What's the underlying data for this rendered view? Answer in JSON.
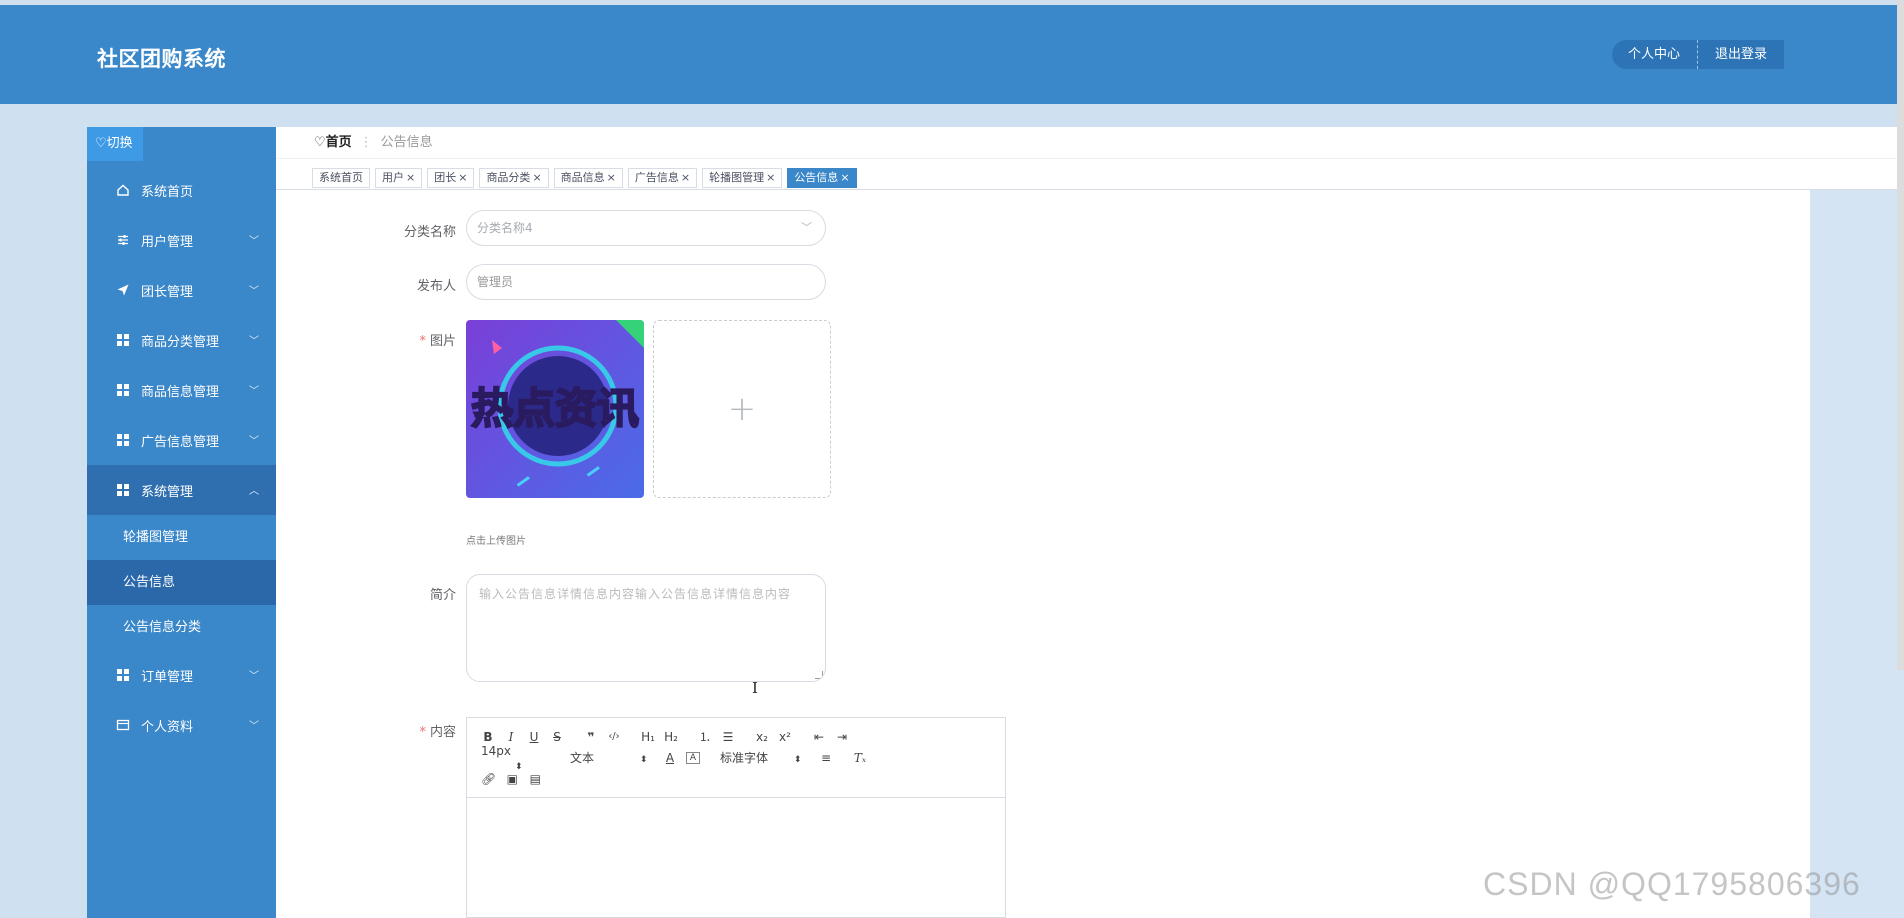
{
  "header": {
    "title": "社区团购系统",
    "personal_center": "个人中心",
    "logout": "退出登录"
  },
  "sidebar": {
    "switch_label": "♡切换",
    "items": [
      {
        "label": "系统首页",
        "icon": "home-icon"
      },
      {
        "label": "用户管理",
        "icon": "sliders-icon"
      },
      {
        "label": "团长管理",
        "icon": "send-icon"
      },
      {
        "label": "商品分类管理",
        "icon": "grid-icon"
      },
      {
        "label": "商品信息管理",
        "icon": "grid-icon"
      },
      {
        "label": "广告信息管理",
        "icon": "grid-icon"
      },
      {
        "label": "系统管理",
        "icon": "grid-icon"
      }
    ],
    "system_sub": [
      "轮播图管理",
      "公告信息",
      "公告信息分类"
    ],
    "items_after": [
      {
        "label": "订单管理",
        "icon": "grid-icon"
      },
      {
        "label": "个人资料",
        "icon": "card-icon"
      }
    ]
  },
  "breadcrumb": {
    "home": "首页",
    "sep": "⋮",
    "current": "公告信息"
  },
  "tabs": [
    {
      "label": "系统首页",
      "closable": false
    },
    {
      "label": "用户",
      "closable": true
    },
    {
      "label": "团长",
      "closable": true
    },
    {
      "label": "商品分类",
      "closable": true
    },
    {
      "label": "商品信息",
      "closable": true
    },
    {
      "label": "广告信息",
      "closable": true
    },
    {
      "label": "轮播图管理",
      "closable": true
    },
    {
      "label": "公告信息",
      "closable": true
    }
  ],
  "form": {
    "category_label": "分类名称",
    "category_value": "分类名称4",
    "publisher_label": "发布人",
    "publisher_value": "管理员",
    "image_label": "图片",
    "image_text": "热点资讯",
    "upload_tip": "点击上传图片",
    "summary_label": "简介",
    "summary_placeholder": "输入公告信息详情信息内容输入公告信息详情信息内容",
    "content_label": "内容"
  },
  "editor": {
    "font_size": "14px",
    "heading": "文本",
    "font_family": "标准字体"
  },
  "watermark": "CSDN @QQ1795806396",
  "colors": {
    "primary": "#3a87c9",
    "active_sub": "#2a68aa",
    "required": "#f56c6c"
  }
}
